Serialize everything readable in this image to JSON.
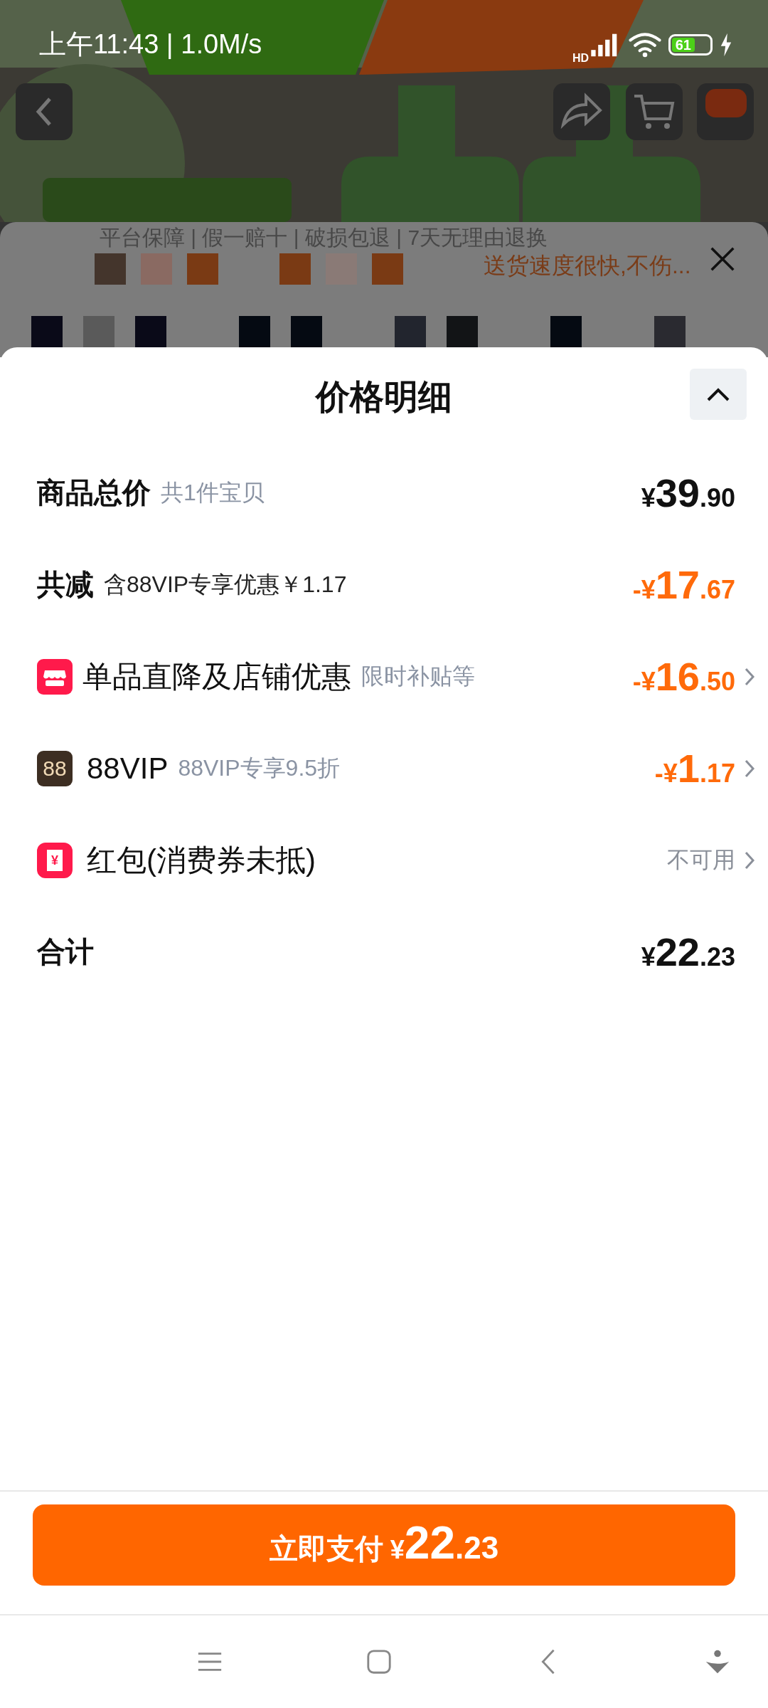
{
  "status_bar": {
    "time": "上午11:43 | 1.0M/s",
    "network": "HD",
    "battery": "61"
  },
  "under_panel": {
    "guarantee": "平台保障 | 假一赔十 | 破损包退 | 7天无理由退换",
    "review": "送货速度很快,不伤..."
  },
  "sheet": {
    "title": "价格明细",
    "rows": [
      {
        "kind": "subtotal",
        "label": "商品总价",
        "note": "共1件宝贝",
        "amount": {
          "sign": "¥",
          "integer": "39",
          "decimal": ".90"
        },
        "chevron": false
      },
      {
        "kind": "reduction",
        "label": "共减",
        "note": "含88VIP专享优惠￥1.17",
        "amount": {
          "sign": "-¥",
          "integer": "17",
          "decimal": ".67"
        },
        "chevron": false
      },
      {
        "kind": "shop_discount",
        "label": "单品直降及店铺优惠",
        "note": "限时补贴等",
        "amount": {
          "sign": "-¥",
          "integer": "16",
          "decimal": ".50"
        },
        "chevron": true
      },
      {
        "kind": "vip_discount",
        "badge": "88",
        "label": "88VIP",
        "note": "88VIP专享9.5折",
        "amount": {
          "sign": "-¥",
          "integer": "1",
          "decimal": ".17"
        },
        "chevron": true
      },
      {
        "kind": "coupon",
        "badge": "¥",
        "label": "红包(消费券未抵)",
        "status": "不可用",
        "chevron": true
      },
      {
        "kind": "total",
        "label": "合计",
        "amount": {
          "sign": "¥",
          "integer": "22",
          "decimal": ".23"
        },
        "chevron": false
      }
    ]
  },
  "pay_button": {
    "label": "立即支付",
    "sign": "¥",
    "integer": "22",
    "decimal": ".23"
  }
}
